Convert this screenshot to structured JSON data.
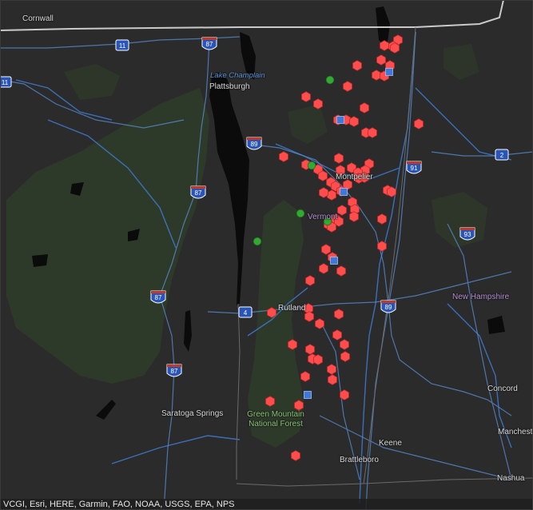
{
  "map": {
    "labels": {
      "cornwall": "Cornwall",
      "plattsburgh": "Plattsburgh",
      "lake_champlain": "Lake Champlain",
      "montpelier": "Montpelier",
      "vermont": "Vermont",
      "rutland": "Rutland",
      "new_hampshire": "New Hampshire",
      "saratoga_springs": "Saratoga Springs",
      "green_mountain_nf": "Green Mountain National Forest",
      "concord": "Concord",
      "manchester": "Manchester",
      "keene": "Keene",
      "brattleboro": "Brattleboro",
      "nashua": "Nashua"
    },
    "shields": {
      "i87_a": "87",
      "i87_b": "87",
      "i87_c": "87",
      "i87_d": "87",
      "i89_a": "89",
      "i89_b": "89",
      "i91": "91",
      "i93": "93",
      "rt11": "11",
      "rt11_edge": "11",
      "rt2": "2",
      "rt4": "4"
    },
    "colors": {
      "background": "#2b2b2b",
      "water": "#0b0b0b",
      "rivers": "#3f77c9",
      "roads": "#5a90d8",
      "forest": "#2f3b2a",
      "marker_red": "#ff4d4d",
      "marker_green": "#33a833",
      "marker_blue": "#3f78d8"
    },
    "marker_counts": {
      "red": 93,
      "green": 5,
      "blue": 5
    },
    "attribution": "VCGI, Esri, HERE, Garmin, FAO, NOAA, USGS, EPA, NPS"
  }
}
